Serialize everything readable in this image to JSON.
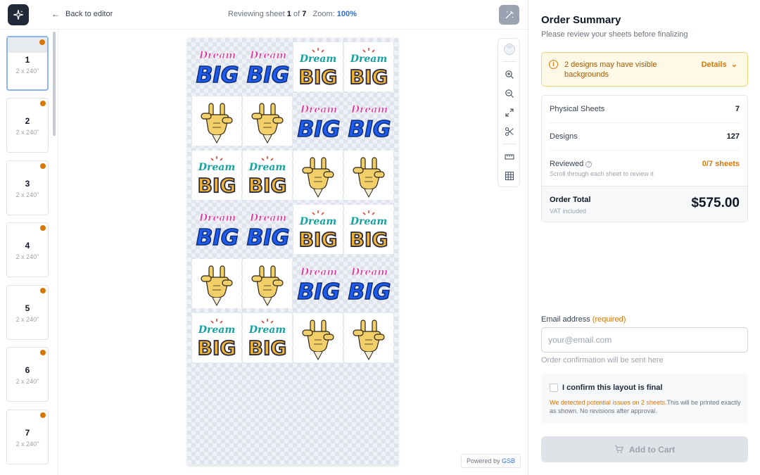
{
  "topbar": {
    "back_label": "Back to editor",
    "review_prefix": "Reviewing sheet",
    "current_sheet": "1",
    "of_word": "of",
    "total_sheets": "7",
    "zoom_label": "Zoom:",
    "zoom_value": "100%"
  },
  "sidebar": {
    "sheets": [
      {
        "num": "1",
        "size": "2 x 240\"",
        "active": true
      },
      {
        "num": "2",
        "size": "2 x 240\""
      },
      {
        "num": "3",
        "size": "2 x 240\""
      },
      {
        "num": "4",
        "size": "2 x 240\""
      },
      {
        "num": "5",
        "size": "2 x 240\""
      },
      {
        "num": "6",
        "size": "2 x 240\""
      },
      {
        "num": "7",
        "size": "2 x 240\""
      }
    ]
  },
  "designs": {
    "dream_word": "Dream",
    "big_word": "BIG",
    "grid": [
      [
        "blue",
        "blue",
        "yellow",
        "yellow"
      ],
      [
        "hand",
        "hand",
        "blue",
        "blue"
      ],
      [
        "yellow",
        "yellow",
        "hand",
        "hand"
      ],
      [
        "blue",
        "blue",
        "yellow",
        "yellow"
      ],
      [
        "hand",
        "hand",
        "blue",
        "blue"
      ],
      [
        "yellow",
        "yellow",
        "hand",
        "hand"
      ]
    ]
  },
  "canvas": {
    "tools": [
      "background-toggle-icon",
      "zoom-in-icon",
      "zoom-out-icon",
      "fit-screen-icon",
      "scissors-icon",
      "ruler-icon",
      "grid-icon"
    ],
    "powered_prefix": "Powered by",
    "powered_brand": "GSB"
  },
  "panel": {
    "title": "Order Summary",
    "subtitle": "Please review your sheets before finalizing",
    "alert_text": "2 designs may have visible backgrounds",
    "alert_details": "Details",
    "physical_sheets_label": "Physical Sheets",
    "physical_sheets_value": "7",
    "designs_label": "Designs",
    "designs_value": "127",
    "reviewed_label": "Reviewed",
    "reviewed_hint": "Scroll through each sheet to review it",
    "reviewed_value": "0/7 sheets",
    "total_label": "Order Total",
    "total_vat": "VAT included",
    "total_value": "$575.00",
    "email_label": "Email address",
    "email_required": "(required)",
    "email_placeholder": "your@email.com",
    "email_note": "Order confirmation will be sent here",
    "confirm_label": "I confirm this layout is final",
    "confirm_warning": "We detected potential issues on 2 sheets.",
    "confirm_rest": "This will be printed exactly as shown. No revisions after approval.",
    "cart_label": "Add to Cart"
  },
  "colors": {
    "accent": "#2f6fe0",
    "warning": "#d97706",
    "dark": "#1f2937"
  }
}
